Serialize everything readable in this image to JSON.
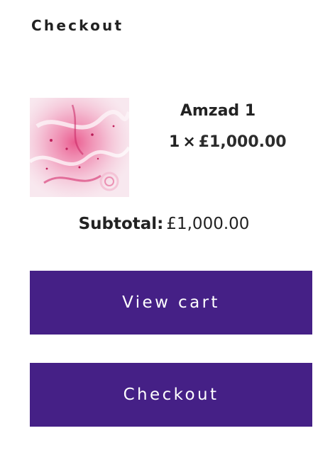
{
  "widget": {
    "heading": "Checkout"
  },
  "cart": {
    "items": [
      {
        "name": "Amzad 1",
        "quantity": "1",
        "times_symbol": "×",
        "price": "£1,000.00",
        "thumbnail_icon": "product-thumbnail-pink-marble"
      }
    ],
    "subtotal_label": "Subtotal:",
    "subtotal_value": "£1,000.00"
  },
  "buttons": {
    "view_cart": "View cart",
    "checkout": "Checkout"
  },
  "colors": {
    "button_bg": "#452086",
    "button_text": "#ffffff",
    "text": "#222222",
    "thumbnail_accent": "#d93a78"
  }
}
